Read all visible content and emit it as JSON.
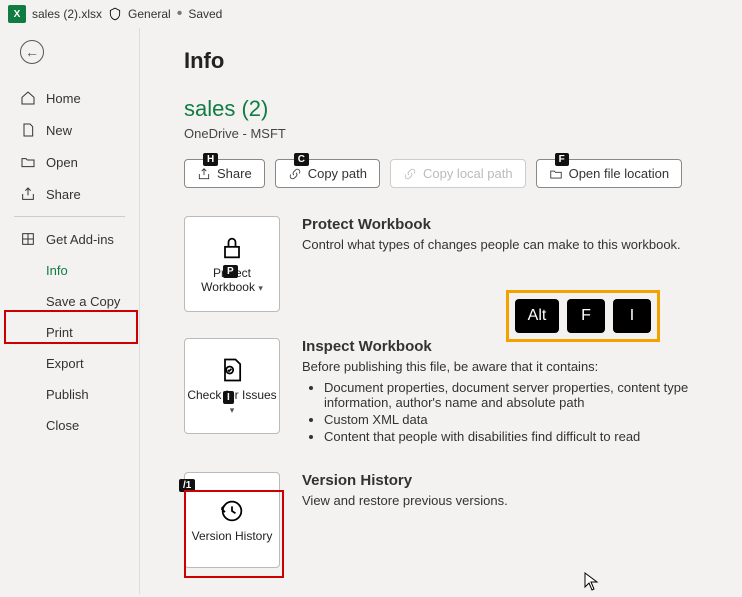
{
  "titlebar": {
    "filename": "sales (2).xlsx",
    "sensitivity": "General",
    "status": "Saved"
  },
  "sidebar": {
    "home": "Home",
    "new": "New",
    "open": "Open",
    "share": "Share",
    "get_addins": "Get Add-ins",
    "info": "Info",
    "save_copy": "Save a Copy",
    "print": "Print",
    "export": "Export",
    "publish": "Publish",
    "close": "Close"
  },
  "page": {
    "title": "Info",
    "doc_name": "sales (2)",
    "doc_location": "OneDrive - MSFT"
  },
  "buttons": {
    "share": "Share",
    "copy_path": "Copy path",
    "copy_local_path": "Copy local path",
    "open_loc": "Open file location"
  },
  "keytips": {
    "share": "H",
    "copy_path": "C",
    "open_loc": "F",
    "protect": "P",
    "issues": "I",
    "history": "/1"
  },
  "sections": {
    "protect": {
      "tile": "Protect Workbook",
      "title": "Protect Workbook",
      "text": "Control what types of changes people can make to this workbook."
    },
    "inspect": {
      "tile": "Check for Issues",
      "title": "Inspect Workbook",
      "intro": "Before publishing this file, be aware that it contains:",
      "items": [
        "Document properties, document server properties, content type information, author's name and absolute path",
        "Custom XML data",
        "Content that people with disabilities find difficult to read"
      ]
    },
    "history": {
      "tile": "Version History",
      "title": "Version History",
      "text": "View and restore previous versions."
    }
  },
  "overlay_keys": [
    "Alt",
    "F",
    "I"
  ]
}
